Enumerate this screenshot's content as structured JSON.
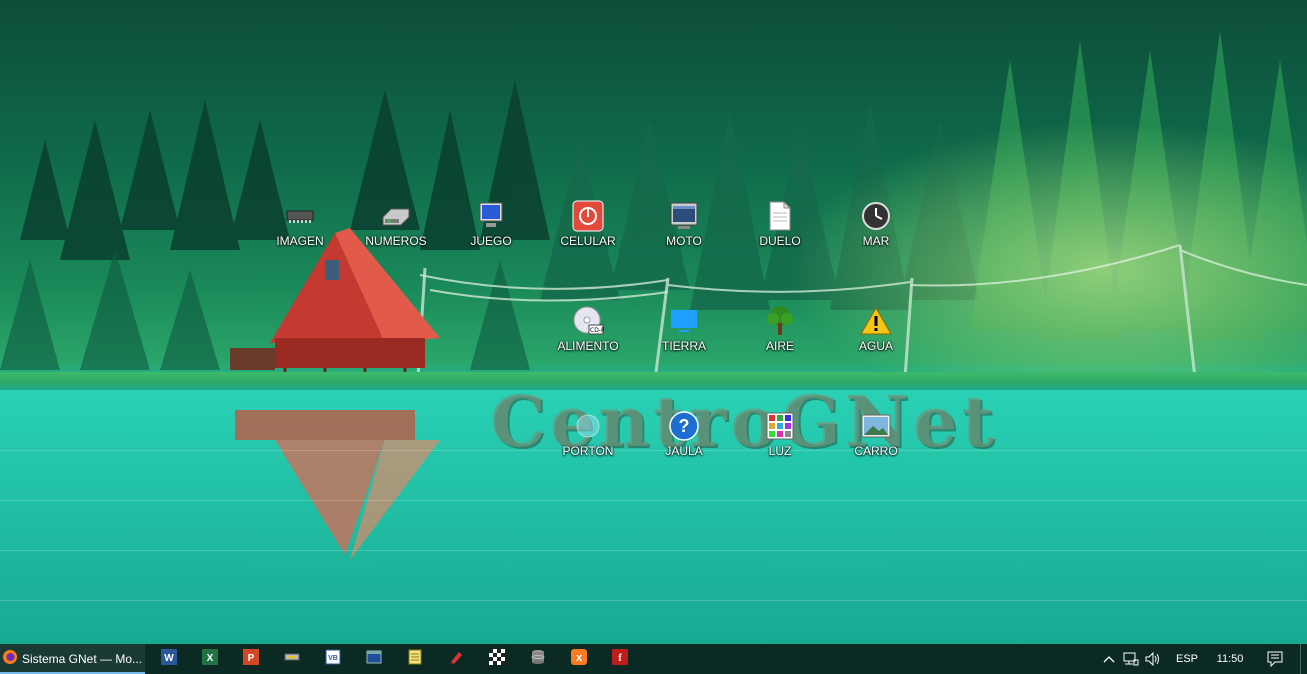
{
  "desktop": {
    "watermark": "CentroGNet",
    "icons": [
      {
        "label": "IMAGEN",
        "icon": "memory-chip-icon"
      },
      {
        "label": "NUMEROS",
        "icon": "drive-icon"
      },
      {
        "label": "JUEGO",
        "icon": "monitor-icon"
      },
      {
        "label": "CELULAR",
        "icon": "power-icon"
      },
      {
        "label": "MOTO",
        "icon": "window-screen-icon"
      },
      {
        "label": "DUELO",
        "icon": "document-icon"
      },
      {
        "label": "MAR",
        "icon": "clock-icon"
      },
      {
        "label": "ALIMENTO",
        "icon": "cd-icon"
      },
      {
        "label": "TIERRA",
        "icon": "display-icon"
      },
      {
        "label": "AIRE",
        "icon": "tree-icon"
      },
      {
        "label": "AGUA",
        "icon": "warning-icon"
      },
      {
        "label": "PORTON",
        "icon": "globe-icon"
      },
      {
        "label": "JAULA",
        "icon": "help-icon"
      },
      {
        "label": "LUZ",
        "icon": "photo-grid-icon"
      },
      {
        "label": "CARRO",
        "icon": "picture-icon"
      }
    ]
  },
  "taskbar": {
    "active_window": {
      "title": "Sistema GNet — Mo...",
      "icon": "firefox-icon"
    },
    "pinned": [
      "word-icon",
      "excel-icon",
      "powerpoint-icon",
      "tool-icon",
      "vb-icon",
      "app-window-icon",
      "notepad-icon",
      "pen-icon",
      "chess-icon",
      "database-icon",
      "xampp-icon",
      "filezilla-icon"
    ],
    "tray": {
      "language": "ESP",
      "time": "11:50",
      "icons": [
        "chevron-up-icon",
        "network-icon",
        "volume-icon",
        "notifications-icon"
      ]
    }
  },
  "colors": {
    "taskbar_bg": "#0b2a23",
    "active_indicator": "#76b9ed",
    "water": "#25c7aa",
    "cabin": "#d9453a"
  }
}
